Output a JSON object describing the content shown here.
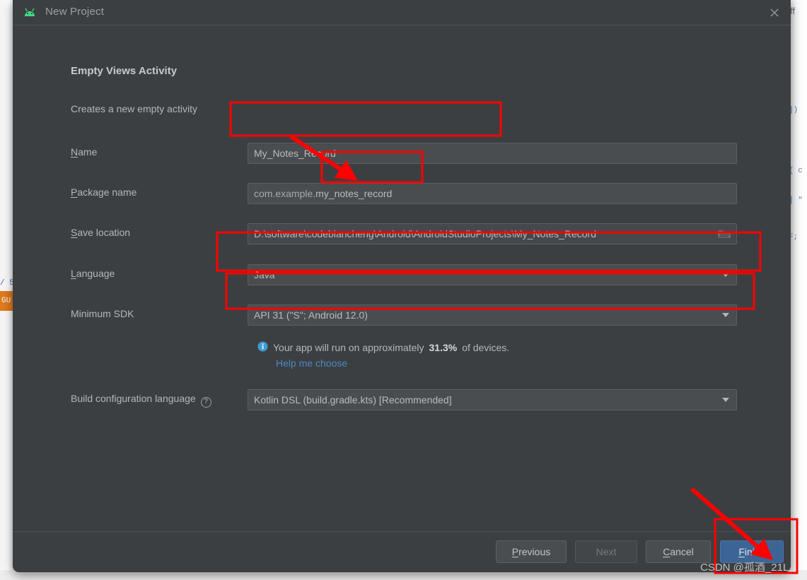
{
  "window": {
    "title": "New Project",
    "app_icon": "android-robot-icon",
    "close_icon": "close-icon"
  },
  "step": {
    "title": "Empty Views Activity",
    "description": "Creates a new empty activity"
  },
  "form": {
    "rows": [
      {
        "label_prefix": "",
        "label_mnemonic": "N",
        "label_suffix": "ame",
        "value": "My_Notes_Record"
      },
      {
        "label_prefix": "",
        "label_mnemonic": "P",
        "label_suffix": "ackage name",
        "value_prefix": "com.example.",
        "value_highlight": "my_notes_record"
      },
      {
        "label_prefix": "",
        "label_mnemonic": "S",
        "label_suffix": "ave location",
        "value": "D:\\software\\codebiancheng\\Android\\AndroidStudioProjects\\My_Notes_Record",
        "browse_icon": "folder-icon"
      },
      {
        "label_prefix": "",
        "label_mnemonic": "L",
        "label_suffix": "anguage",
        "value": "Java",
        "caret_icon": "chevron-down-icon"
      },
      {
        "label_prefix": "",
        "label_mnemonic": "",
        "label_suffix": "Minimum SDK",
        "value": "API 31 (\"S\"; Android 12.0)",
        "caret_icon": "chevron-down-icon"
      }
    ],
    "build_config": {
      "label": "Build configuration language",
      "help_icon": "question-mark-icon",
      "help_glyph": "?",
      "value": "Kotlin DSL (build.gradle.kts) [Recommended]",
      "caret_icon": "chevron-down-icon"
    }
  },
  "info": {
    "icon": "info-icon",
    "text_before": "Your app will run on approximately",
    "percent": "31.3%",
    "text_after": "of devices.",
    "link": "Help me choose"
  },
  "buttons": {
    "previous": {
      "prefix": "",
      "mnemonic": "P",
      "suffix": "revious"
    },
    "next": {
      "label": "Next",
      "disabled": true
    },
    "cancel": {
      "prefix": "",
      "mnemonic": "C",
      "suffix": "ancel"
    },
    "finish": {
      "prefix": "",
      "mnemonic": "F",
      "suffix": "inish",
      "primary": true
    }
  },
  "watermark": "CSDN @孤酒_21L",
  "colors": {
    "dialog_bg": "#3c3f41",
    "field_bg": "#4a4d4f",
    "accent_link": "#4a88c7",
    "primary_button": "#3c6494",
    "annotation": "#ff0000",
    "android_green": "#3ddc84",
    "info_blue": "#3f9bd4",
    "badge_orange": "#e07b1d"
  },
  "background": {
    "left_code": "/ 5",
    "left_badge": "GU",
    "right_title": "ff",
    "right_fragments": [
      "])",
      "{ c",
      "] \"",
      "F;"
    ]
  }
}
